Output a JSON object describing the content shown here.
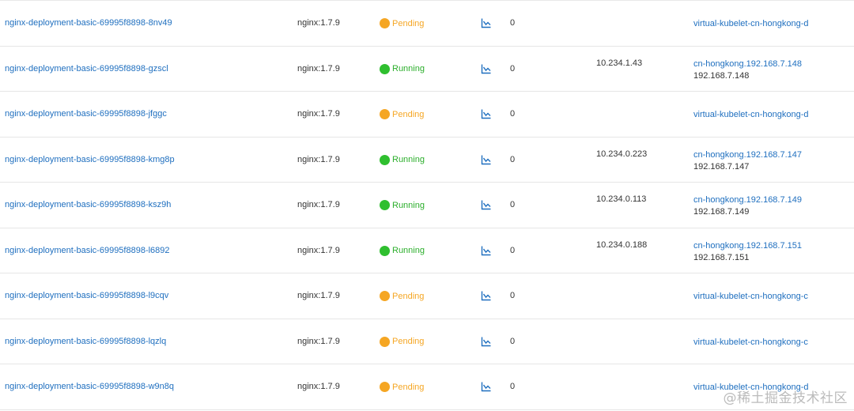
{
  "colors": {
    "link": "#1f6fbf",
    "pending": "#f5a623",
    "running": "#2fbf2f",
    "pending_text": "#f5a623",
    "running_text": "#2bae2b"
  },
  "pods": [
    {
      "name": "nginx-deployment-basic-69995f8898-8nv49",
      "image": "nginx:1.7.9",
      "status": "Pending",
      "monitor_icon": "line-chart-icon",
      "restarts": "0",
      "pod_ip": "",
      "node_name": "virtual-kubelet-cn-hongkong-d",
      "node_ip": ""
    },
    {
      "name": "nginx-deployment-basic-69995f8898-gzscl",
      "image": "nginx:1.7.9",
      "status": "Running",
      "monitor_icon": "line-chart-icon",
      "restarts": "0",
      "pod_ip": "10.234.1.43",
      "node_name": "cn-hongkong.192.168.7.148",
      "node_ip": "192.168.7.148"
    },
    {
      "name": "nginx-deployment-basic-69995f8898-jfggc",
      "image": "nginx:1.7.9",
      "status": "Pending",
      "monitor_icon": "line-chart-icon",
      "restarts": "0",
      "pod_ip": "",
      "node_name": "virtual-kubelet-cn-hongkong-d",
      "node_ip": ""
    },
    {
      "name": "nginx-deployment-basic-69995f8898-kmg8p",
      "image": "nginx:1.7.9",
      "status": "Running",
      "monitor_icon": "line-chart-icon",
      "restarts": "0",
      "pod_ip": "10.234.0.223",
      "node_name": "cn-hongkong.192.168.7.147",
      "node_ip": "192.168.7.147"
    },
    {
      "name": "nginx-deployment-basic-69995f8898-ksz9h",
      "image": "nginx:1.7.9",
      "status": "Running",
      "monitor_icon": "line-chart-icon",
      "restarts": "0",
      "pod_ip": "10.234.0.113",
      "node_name": "cn-hongkong.192.168.7.149",
      "node_ip": "192.168.7.149"
    },
    {
      "name": "nginx-deployment-basic-69995f8898-l6892",
      "image": "nginx:1.7.9",
      "status": "Running",
      "monitor_icon": "line-chart-icon",
      "restarts": "0",
      "pod_ip": "10.234.0.188",
      "node_name": "cn-hongkong.192.168.7.151",
      "node_ip": "192.168.7.151"
    },
    {
      "name": "nginx-deployment-basic-69995f8898-l9cqv",
      "image": "nginx:1.7.9",
      "status": "Pending",
      "monitor_icon": "line-chart-icon",
      "restarts": "0",
      "pod_ip": "",
      "node_name": "virtual-kubelet-cn-hongkong-c",
      "node_ip": ""
    },
    {
      "name": "nginx-deployment-basic-69995f8898-lqzlq",
      "image": "nginx:1.7.9",
      "status": "Pending",
      "monitor_icon": "line-chart-icon",
      "restarts": "0",
      "pod_ip": "",
      "node_name": "virtual-kubelet-cn-hongkong-c",
      "node_ip": ""
    },
    {
      "name": "nginx-deployment-basic-69995f8898-w9n8q",
      "image": "nginx:1.7.9",
      "status": "Pending",
      "monitor_icon": "line-chart-icon",
      "restarts": "0",
      "pod_ip": "",
      "node_name": "virtual-kubelet-cn-hongkong-d",
      "node_ip": ""
    }
  ],
  "watermark": {
    "text": "@稀土掘金技术社区",
    "icon": "watermark-logo-icon"
  }
}
